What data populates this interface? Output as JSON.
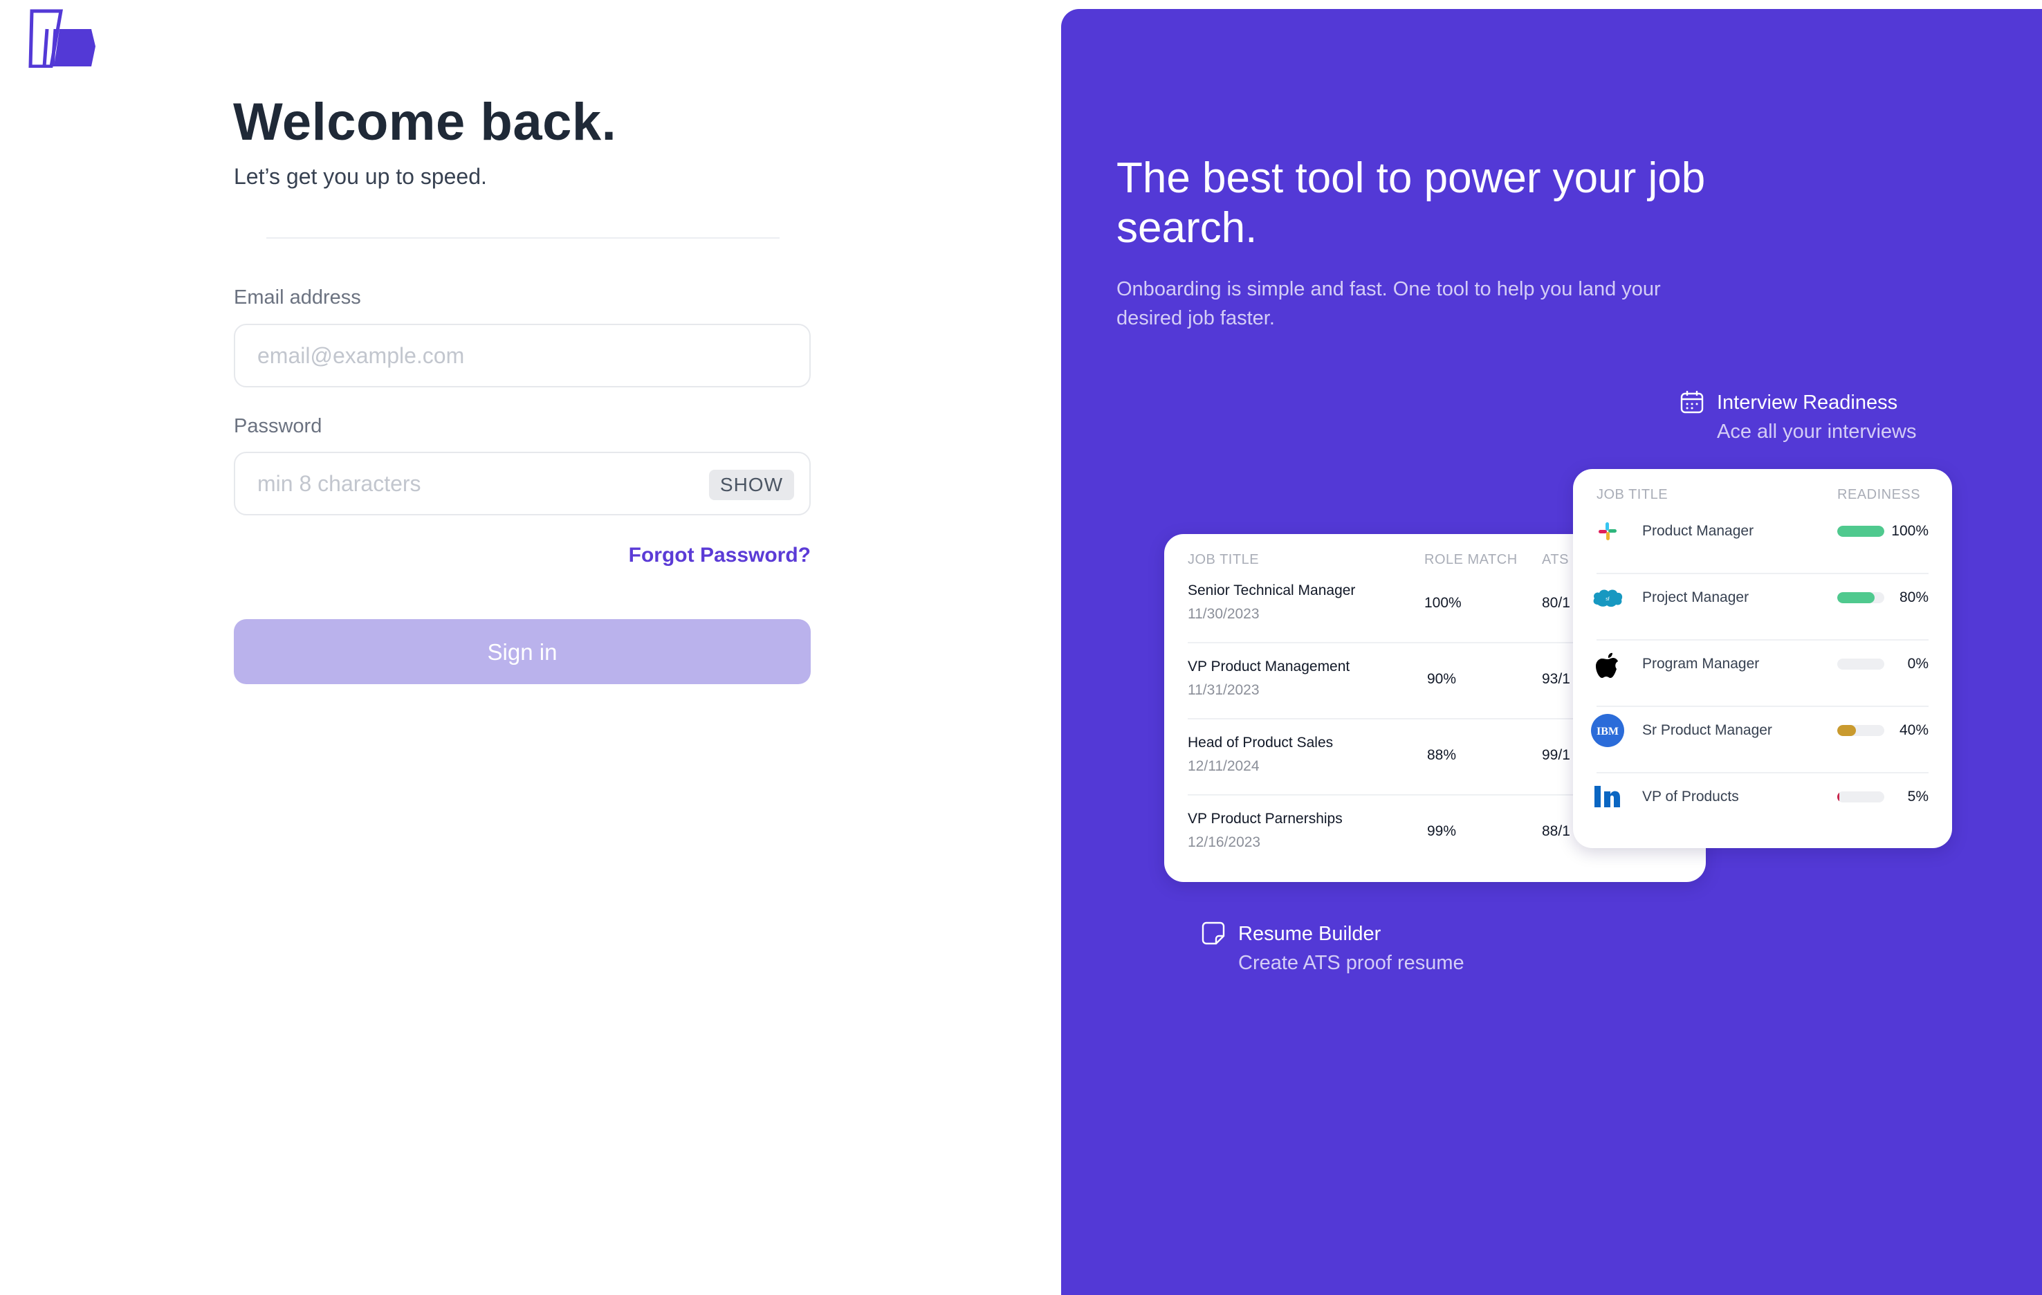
{
  "login": {
    "title": "Welcome back.",
    "subtitle": "Let’s get you up to speed.",
    "email_label": "Email address",
    "email_placeholder": "email@example.com",
    "email_value": "",
    "password_label": "Password",
    "password_placeholder": "min 8 characters",
    "password_value": "",
    "show_label": "SHOW",
    "forgot_label": "Forgot Password?",
    "signin_label": "Sign in"
  },
  "promo": {
    "title": "The best tool to power your job search.",
    "description": "Onboarding is simple and fast. One tool to help you land your desired job faster.",
    "interview": {
      "title": "Interview Readiness",
      "subtitle": "Ace all your interviews",
      "icon": "calendar-icon"
    },
    "resume": {
      "title": "Resume Builder",
      "subtitle": "Create ATS proof resume",
      "icon": "document-icon"
    }
  },
  "role_table": {
    "headers": [
      "JOB TITLE",
      "ROLE MATCH",
      "ATS"
    ],
    "rows": [
      {
        "title": "Senior Technical Manager",
        "date": "11/30/2023",
        "role_match": "100%",
        "ats": "80/1"
      },
      {
        "title": "VP Product Management",
        "date": "11/31/2023",
        "role_match": "90%",
        "ats": "93/1"
      },
      {
        "title": "Head of Product Sales",
        "date": "12/11/2024",
        "role_match": "88%",
        "ats": "99/1"
      },
      {
        "title": "VP Product Parnerships",
        "date": "12/16/2023",
        "role_match": "99%",
        "ats": "88/1"
      }
    ]
  },
  "readiness_table": {
    "headers": [
      "JOB TITLE",
      "READINESS"
    ],
    "rows": [
      {
        "company_icon": "slack-icon",
        "title": "Product Manager",
        "readiness": 100,
        "label": "100%",
        "color": "#4fc98e"
      },
      {
        "company_icon": "salesforce-icon",
        "title": "Project Manager",
        "readiness": 80,
        "label": "80%",
        "color": "#4fc98e"
      },
      {
        "company_icon": "apple-icon",
        "title": "Program Manager",
        "readiness": 0,
        "label": "0%",
        "color": "#4fc98e"
      },
      {
        "company_icon": "ibm-icon",
        "title": "Sr Product Manager",
        "readiness": 40,
        "label": "40%",
        "color": "#c99a2e"
      },
      {
        "company_icon": "linkedin-icon",
        "title": "VP of Products",
        "readiness": 5,
        "label": "5%",
        "color": "#c8234a"
      }
    ]
  },
  "colors": {
    "brand": "#5339d6",
    "button_disabled": "#bab2ec",
    "link": "#5b3bd6"
  }
}
